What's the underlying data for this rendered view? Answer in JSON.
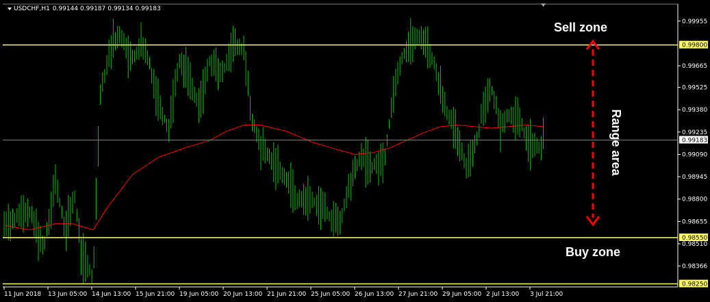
{
  "chart_data": {
    "type": "candlestick",
    "symbol": "USDCHF,H1",
    "ohlc_header": [
      "0.99144",
      "0.99187",
      "0.99134",
      "0.99183"
    ],
    "x_ticks": [
      "11 Jun 2018",
      "13 Jun 05:00",
      "14 Jun 13:00",
      "15 Jun 21:00",
      "19 Jun 05:00",
      "20 Jun 13:00",
      "21 Jun 21:00",
      "25 Jun 05:00",
      "26 Jun 13:00",
      "27 Jun 21:00",
      "29 Jun 05:00",
      "2 Jul 13:00",
      "3 Jul 21:00"
    ],
    "y_ticks": [
      "0.99955",
      "0.99665",
      "0.99525",
      "0.99380",
      "0.99235",
      "0.99090",
      "0.98945",
      "0.98800",
      "0.98655",
      "0.98510",
      "0.98366"
    ],
    "ylim": [
      0.9823,
      1.00065
    ],
    "current_price": "0.99183",
    "levels": [
      {
        "name": "Sell zone",
        "price": "0.99800",
        "color": "#ffff66"
      },
      {
        "name": "Buy zone",
        "price": "0.98550",
        "color": "#ffff66"
      },
      {
        "name": "",
        "price": "0.98250",
        "color": "#ffff66"
      }
    ],
    "range_label": "Range area",
    "colors": {
      "background": "#000000",
      "candles": "#00c000",
      "ma": "#ff0000",
      "level": "#ffff66",
      "arrow": "#ff0000",
      "grid": "#808080"
    },
    "price_path": [
      [
        0,
        0.9864
      ],
      [
        1.5,
        0.9872
      ],
      [
        2.3,
        0.9848
      ],
      [
        3.0,
        0.9892
      ],
      [
        3.6,
        0.9858
      ],
      [
        4.1,
        0.9884
      ],
      [
        4.5,
        0.9845
      ],
      [
        5.0,
        0.9833
      ],
      [
        5.2,
        0.9828
      ],
      [
        5.6,
        0.9948
      ],
      [
        6.2,
        0.9978
      ],
      [
        6.8,
        0.9988
      ],
      [
        7.4,
        0.9969
      ],
      [
        8.0,
        0.998
      ],
      [
        8.5,
        0.9968
      ],
      [
        9.0,
        0.9944
      ],
      [
        9.6,
        0.9925
      ],
      [
        10.2,
        0.997
      ],
      [
        10.8,
        0.996
      ],
      [
        11.4,
        0.9938
      ],
      [
        12.0,
        0.997
      ],
      [
        12.7,
        0.996
      ],
      [
        13.3,
        0.998
      ],
      [
        14.0,
        0.9977
      ],
      [
        14.5,
        0.993
      ],
      [
        15.0,
        0.9913
      ],
      [
        15.7,
        0.9905
      ],
      [
        16.4,
        0.9895
      ],
      [
        17.1,
        0.988
      ],
      [
        17.8,
        0.988
      ],
      [
        18.5,
        0.9876
      ],
      [
        19.1,
        0.9868
      ],
      [
        19.6,
        0.9863
      ],
      [
        20.1,
        0.9886
      ],
      [
        20.8,
        0.9908
      ],
      [
        21.5,
        0.9901
      ],
      [
        22.2,
        0.9904
      ],
      [
        22.8,
        0.9954
      ],
      [
        23.3,
        0.9974
      ],
      [
        23.8,
        0.9982
      ],
      [
        24.4,
        0.9986
      ],
      [
        25.0,
        0.9972
      ],
      [
        25.8,
        0.994
      ],
      [
        26.3,
        0.9924
      ],
      [
        27.0,
        0.9902
      ],
      [
        27.6,
        0.9917
      ],
      [
        28.0,
        0.9942
      ],
      [
        28.5,
        0.995
      ],
      [
        29.0,
        0.9928
      ],
      [
        29.6,
        0.9936
      ],
      [
        30.2,
        0.9928
      ],
      [
        30.7,
        0.9915
      ],
      [
        31.3,
        0.9913
      ],
      [
        31.5,
        0.99183
      ]
    ],
    "ma_path": [
      [
        0,
        0.9863
      ],
      [
        1.5,
        0.986
      ],
      [
        3.0,
        0.9864
      ],
      [
        4.0,
        0.9864
      ],
      [
        5.2,
        0.986
      ],
      [
        6.0,
        0.9874
      ],
      [
        7.5,
        0.9896
      ],
      [
        9.0,
        0.9907
      ],
      [
        10.5,
        0.9913
      ],
      [
        12.0,
        0.9918
      ],
      [
        13.0,
        0.9924
      ],
      [
        14.0,
        0.9928
      ],
      [
        15.0,
        0.9928
      ],
      [
        16.5,
        0.9924
      ],
      [
        18.0,
        0.9917
      ],
      [
        19.5,
        0.9912
      ],
      [
        20.5,
        0.9909
      ],
      [
        21.5,
        0.991
      ],
      [
        22.5,
        0.9913
      ],
      [
        23.5,
        0.9918
      ],
      [
        24.5,
        0.9923
      ],
      [
        25.5,
        0.9927
      ],
      [
        26.5,
        0.9928
      ],
      [
        27.5,
        0.9927
      ],
      [
        28.5,
        0.9926
      ],
      [
        29.5,
        0.9927
      ],
      [
        30.5,
        0.9928
      ],
      [
        31.5,
        0.9927
      ]
    ]
  }
}
